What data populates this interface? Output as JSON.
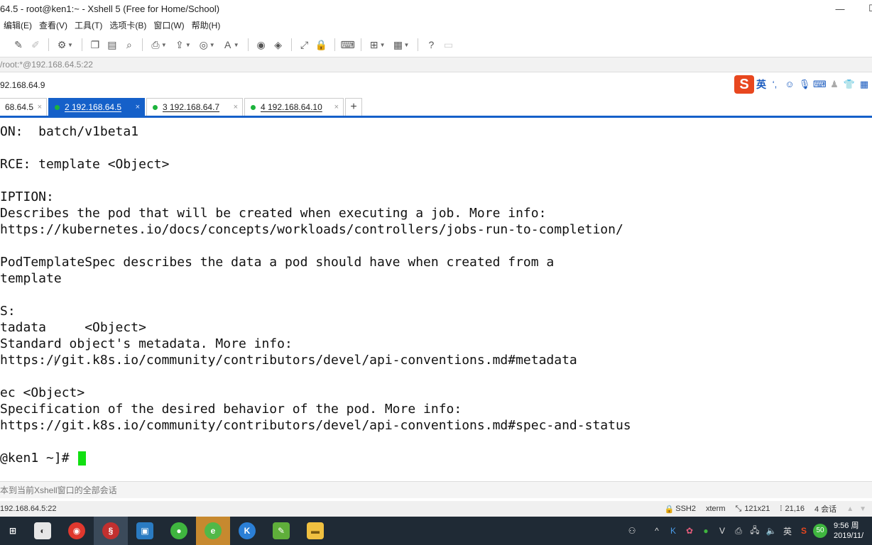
{
  "window": {
    "title": "64.5 - root@ken1:~ - Xshell 5 (Free for Home/School)",
    "minimize": "—",
    "maximize": "☐"
  },
  "menu": [
    "编辑(E)",
    "查看(V)",
    "工具(T)",
    "选项卡(B)",
    "窗口(W)",
    "帮助(H)"
  ],
  "address": "/root:*@192.168.64.5:22",
  "session_host": "92.168.64.9",
  "ime": {
    "label": "英"
  },
  "tabs": [
    {
      "label": "68.64.5",
      "active": false,
      "dot": false
    },
    {
      "label": "2 192.168.64.5",
      "active": true,
      "dot": true
    },
    {
      "label": "3 192.168.64.7",
      "active": false,
      "dot": true
    },
    {
      "label": "4 192.168.64.10",
      "active": false,
      "dot": true
    }
  ],
  "tab_add": "+",
  "terminal": {
    "lines": [
      "ON:  batch/v1beta1",
      "",
      "RCE: template <Object>",
      "",
      "IPTION:",
      "Describes the pod that will be created when executing a job. More info:",
      "https://kubernetes.io/docs/concepts/workloads/controllers/jobs-run-to-completion/",
      "",
      "PodTemplateSpec describes the data a pod should have when created from a",
      "template",
      "",
      "S:",
      "tadata     <Object>",
      "Standard object's metadata. More info:",
      "https://git.k8s.io/community/contributors/devel/api-conventions.md#metadata",
      "",
      "ec <Object>",
      "Specification of the desired behavior of the pod. More info:",
      "https://git.k8s.io/community/contributors/devel/api-conventions.md#spec-and-status",
      "",
      "@ken1 ~]# "
    ]
  },
  "compose_text": "本到当前Xshell窗口的全部会话",
  "status": {
    "host": "192.168.64.5:22",
    "protocol": "SSH2",
    "term": "xterm",
    "size": "121x21",
    "cursor_pos": "21,16",
    "sessions": "4 会话"
  },
  "taskbar": {
    "apps": [
      "start",
      "folder-app",
      "chrome",
      "xshell",
      "vm-app",
      "wechat",
      "browser-green",
      "kuaishou-app",
      "notepad-app",
      "file-explorer"
    ],
    "tray_lang": "英",
    "badge": "50",
    "time": "9:56 周",
    "date": "2019/11/"
  },
  "colors": {
    "tab_active": "#1560c9",
    "cursor": "#12e012",
    "ime_brand": "#e8471f"
  }
}
